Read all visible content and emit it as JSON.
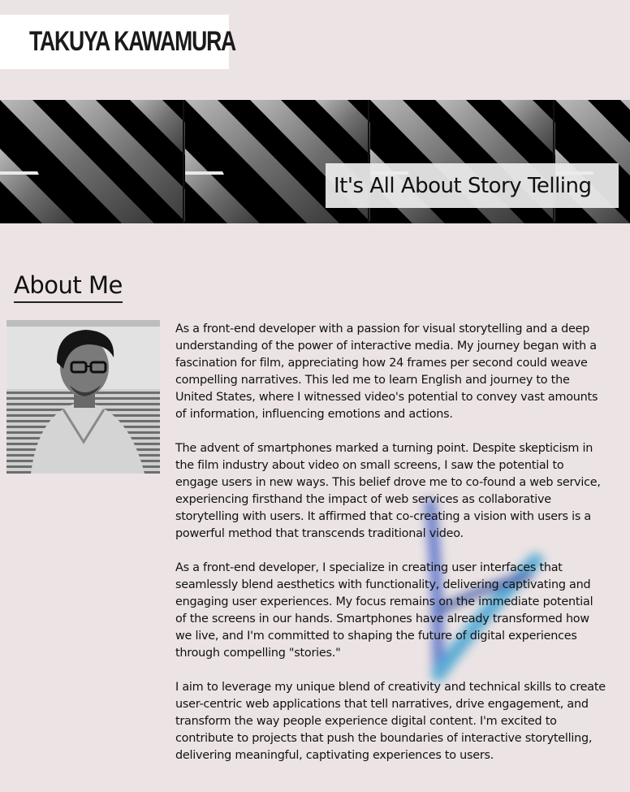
{
  "header": {
    "logo_text": "TAKUYA KAWAMURA"
  },
  "banner": {
    "caption": "It's All About Story Telling"
  },
  "about": {
    "title": "About Me",
    "paragraphs": [
      "As a front-end developer with a passion for visual storytelling and a deep understanding of the power of interactive media. My journey began with a fascination for film, appreciating how 24 frames per second could weave compelling narratives. This led me to learn English and journey to the United States, where I witnessed video's potential to convey vast amounts of information, influencing emotions and actions.",
      "The advent of smartphones marked a turning point. Despite skepticism in the film industry about video on small screens, I saw the potential to engage users in new ways. This belief drove me to co-found a web service, experiencing firsthand the impact of web services as collaborative storytelling with users. It affirmed that co-creating a vision with users is a powerful method that transcends traditional video.",
      "As a front-end developer, I specialize in creating user interfaces that seamlessly blend aesthetics with functionality, delivering captivating and engaging user experiences. My focus remains on the immediate potential of the screens in our hands. Smartphones have already transformed how we live, and I'm committed to shaping the future of digital experiences through compelling \"stories.\"",
      "I aim to leverage my unique blend of creativity and technical skills to create user-centric web applications that tell narratives, drive engagement, and transform the way people experience digital content. I'm excited to contribute to projects that push the boundaries of interactive storytelling, delivering meaningful, captivating experiences to users."
    ]
  },
  "colors": {
    "page_background": "#ece4e4",
    "banner_background": "#000000",
    "stroke_accent": "#2a4fb0"
  }
}
